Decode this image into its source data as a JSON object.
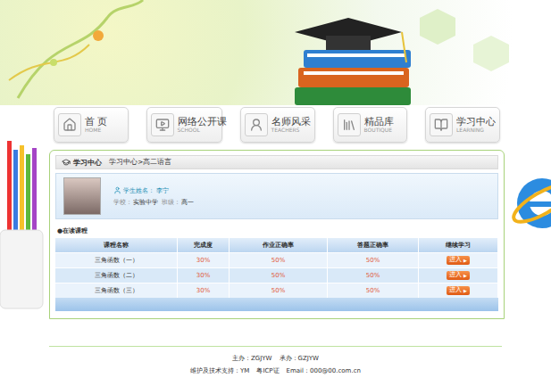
{
  "nav": [
    {
      "label": "首 页",
      "en": "HOME"
    },
    {
      "label": "网络公开课",
      "en": "SCHOOL"
    },
    {
      "label": "名师风采",
      "en": "TEACHERS"
    },
    {
      "label": "精品库",
      "en": "BOUTIQUE"
    },
    {
      "label": "学习中心",
      "en": "LEARNING"
    }
  ],
  "panel": {
    "title": "学习中心",
    "breadcrumb": "学习中心>高二语言"
  },
  "student": {
    "name_label": "学生姓名：",
    "name": "李宁",
    "school_label": "学校：",
    "school": "实验中学",
    "class_label": "班级：",
    "class": "高一"
  },
  "courses": {
    "bullet": "●",
    "title": "在读课程",
    "columns": [
      "课程名称",
      "完成度",
      "作业正确率",
      "答题正确率",
      "继续学习"
    ],
    "rows": [
      {
        "name": "三角函数（一）",
        "completion": "30%",
        "homework": "50%",
        "answers": "50%",
        "action": "进入",
        "arrow": "▶"
      },
      {
        "name": "三角函数（二）",
        "completion": "30%",
        "homework": "50%",
        "answers": "50%",
        "action": "进入",
        "arrow": "▶"
      },
      {
        "name": "三角函数（三）",
        "completion": "30%",
        "homework": "50%",
        "answers": "50%",
        "action": "进入",
        "arrow": "▶"
      }
    ]
  },
  "footer": {
    "line1": [
      "主办：ZGJYW",
      "承办：GZJYW"
    ],
    "line2": [
      "维护及技术支持：YM",
      "粤ICP证",
      "Email：000@00.com.cn"
    ]
  }
}
